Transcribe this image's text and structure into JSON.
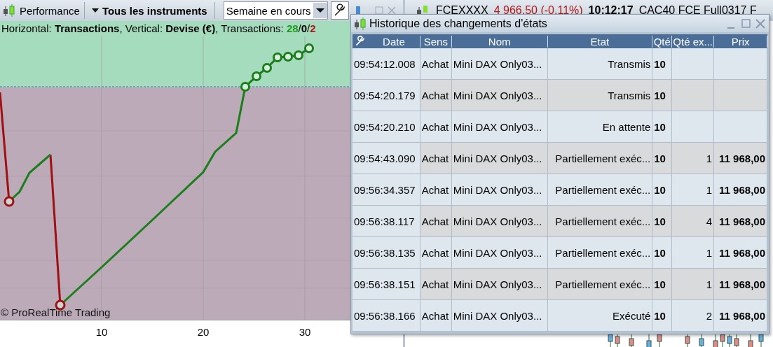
{
  "toolbar": {
    "title": "Performance",
    "instruments": "Tous les instruments",
    "period": "Semaine en cours"
  },
  "info_line": {
    "text": "Horizontal: **Transactions**, Vertical: **Devise (€)**, Transactions:",
    "separator": "/",
    "counts": [
      {
        "value": "28",
        "color": "#1f9a1f"
      },
      {
        "value": "0",
        "color": "#000000"
      },
      {
        "value": "2",
        "color": "#b01818"
      }
    ]
  },
  "chart": {
    "watermark": "© ProRealTime Trading",
    "x_ticks": [
      "10",
      "20",
      "30"
    ]
  },
  "background_window": {
    "symbol": "FCEXXXX",
    "quote": "4 966,50 (-0,11%)",
    "time": "10:12:17",
    "title": "CAC40 FCE Full0317 F"
  },
  "dialog": {
    "title": "Historique des changements d'états",
    "columns": [
      "Date",
      "Sens",
      "Nom",
      "Etat",
      "Qté",
      "Qté ex...",
      "Prix"
    ],
    "rows": [
      [
        "09:54:12.008",
        "Achat",
        "Mini DAX Only03...",
        "Transmis",
        "10",
        "",
        ""
      ],
      [
        "09:54:20.179",
        "Achat",
        "Mini DAX Only03...",
        "Transmis",
        "10",
        "",
        ""
      ],
      [
        "09:54:20.210",
        "Achat",
        "Mini DAX Only03...",
        "En attente",
        "10",
        "",
        ""
      ],
      [
        "09:54:43.090",
        "Achat",
        "Mini DAX Only03...",
        "Partiellement exéc...",
        "10",
        "1",
        "11 968,00"
      ],
      [
        "09:56:34.357",
        "Achat",
        "Mini DAX Only03...",
        "Partiellement exéc...",
        "10",
        "1",
        "11 968,00"
      ],
      [
        "09:56:38.117",
        "Achat",
        "Mini DAX Only03...",
        "Partiellement exéc...",
        "10",
        "4",
        "11 968,00"
      ],
      [
        "09:56:38.135",
        "Achat",
        "Mini DAX Only03...",
        "Partiellement exéc...",
        "10",
        "1",
        "11 968,00"
      ],
      [
        "09:56:38.151",
        "Achat",
        "Mini DAX Only03...",
        "Partiellement exéc...",
        "10",
        "1",
        "11 968,00"
      ],
      [
        "09:56:38.166",
        "Achat",
        "Mini DAX Only03...",
        "Exécuté",
        "10",
        "2",
        "11 968,00"
      ]
    ]
  }
}
